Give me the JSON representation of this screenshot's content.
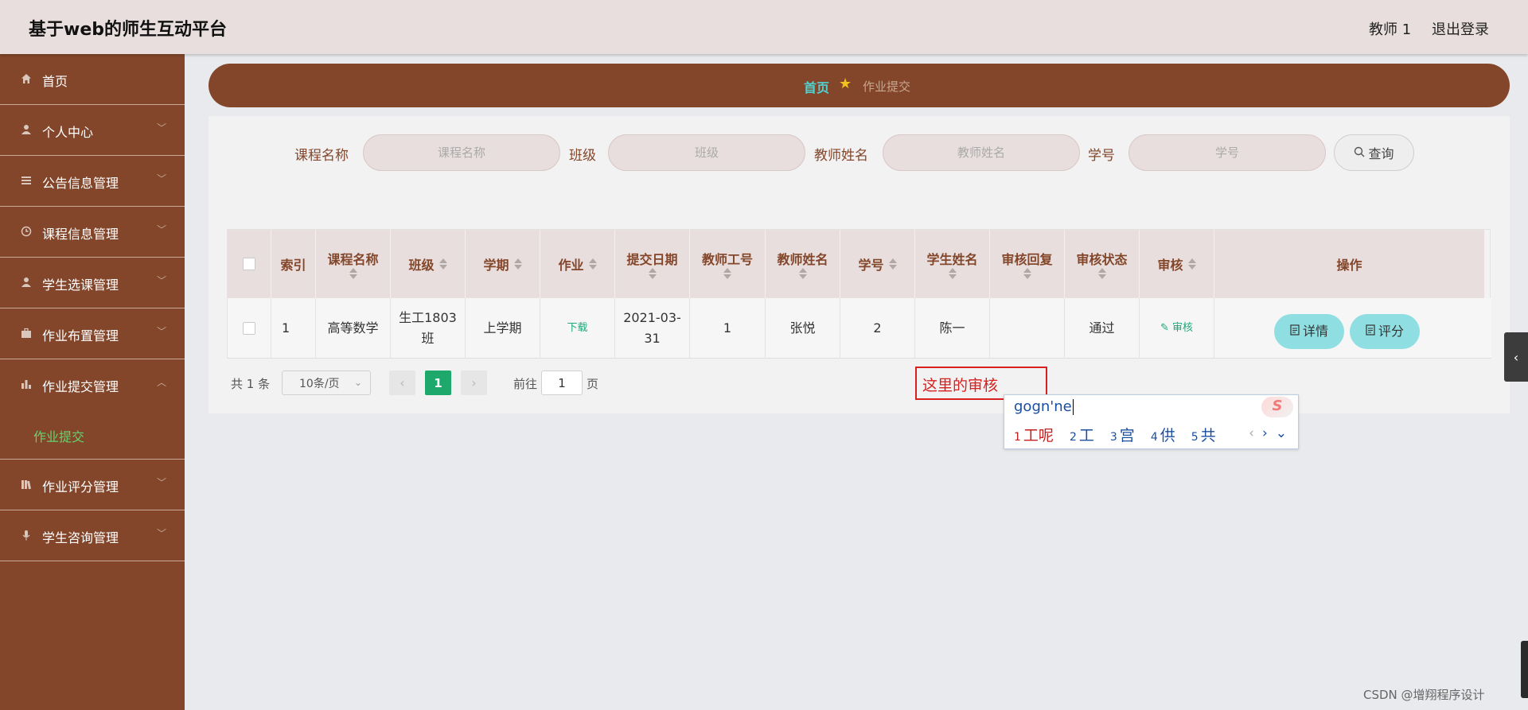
{
  "header": {
    "app_title": "基于web的师生互动平台",
    "user_name": "教师 1",
    "logout_label": "退出登录"
  },
  "sidebar": {
    "items": [
      {
        "label": "首页",
        "icon": "home-icon"
      },
      {
        "label": "个人中心",
        "icon": "user-icon"
      },
      {
        "label": "公告信息管理",
        "icon": "list-icon"
      },
      {
        "label": "课程信息管理",
        "icon": "clock-icon"
      },
      {
        "label": "学生选课管理",
        "icon": "user-icon"
      },
      {
        "label": "作业布置管理",
        "icon": "briefcase-icon"
      },
      {
        "label": "作业提交管理",
        "icon": "chart-icon",
        "expanded": true,
        "children": [
          {
            "label": "作业提交",
            "active": true
          }
        ]
      },
      {
        "label": "作业评分管理",
        "icon": "books-icon"
      },
      {
        "label": "学生咨询管理",
        "icon": "mic-icon"
      }
    ]
  },
  "breadcrumb": {
    "home": "首页",
    "current": "作业提交"
  },
  "search": {
    "course_label": "课程名称",
    "course_placeholder": "课程名称",
    "class_label": "班级",
    "class_placeholder": "班级",
    "teacher_label": "教师姓名",
    "teacher_placeholder": "教师姓名",
    "student_no_label": "学号",
    "student_no_placeholder": "学号",
    "button": "查询"
  },
  "table": {
    "headers": [
      "索引",
      "课程名称",
      "班级",
      "学期",
      "作业",
      "提交日期",
      "教师工号",
      "教师姓名",
      "学号",
      "学生姓名",
      "审核回复",
      "审核状态",
      "审核",
      "操作"
    ],
    "rows": [
      {
        "index": "1",
        "course": "高等数学",
        "class_l1": "生工1803",
        "class_l2": "班",
        "term": "上学期",
        "homework": "下载",
        "date_l1": "2021-03-",
        "date_l2": "31",
        "teacher_no": "1",
        "teacher_name": "张悦",
        "student_no": "2",
        "student_name": "陈一",
        "reply": "",
        "status": "通过",
        "audit": "审核",
        "btn_detail": "详情",
        "btn_score": "评分"
      }
    ]
  },
  "pagination": {
    "total": "共 1 条",
    "page_size": "10条/页",
    "current_page": "1",
    "goto_label": "前往",
    "goto_value": "1",
    "page_unit": "页"
  },
  "annotation": "这里的审核",
  "ime": {
    "composition": "gogn'ne",
    "candidates": [
      {
        "n": "1",
        "text": "工呢"
      },
      {
        "n": "2",
        "text": "工"
      },
      {
        "n": "3",
        "text": "宫"
      },
      {
        "n": "4",
        "text": "供"
      },
      {
        "n": "5",
        "text": "共"
      }
    ],
    "logo": "S"
  },
  "watermark": "CSDN @增翔程序设计",
  "colors": {
    "brand": "#83462a",
    "header_bg": "#e8dedd",
    "accent_green": "#1ea86b",
    "pill_teal": "#8fdfe2",
    "annotation_red": "#d72020"
  }
}
